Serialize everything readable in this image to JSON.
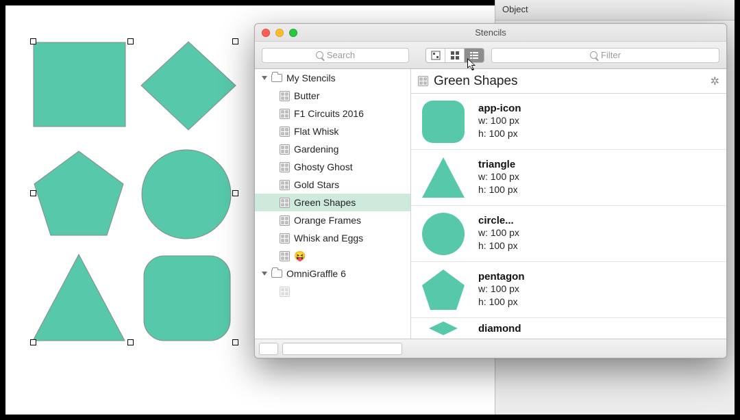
{
  "inspector": {
    "tab_label": "Object"
  },
  "canvas": {
    "shape_color": "#57c9aa"
  },
  "window": {
    "title": "Stencils",
    "search_placeholder": "Search",
    "filter_placeholder": "Filter"
  },
  "sidebar": {
    "groups": [
      {
        "label": "My Stencils",
        "items": [
          {
            "label": "Butter"
          },
          {
            "label": "F1 Circuits 2016"
          },
          {
            "label": "Flat Whisk"
          },
          {
            "label": "Gardening"
          },
          {
            "label": "Ghosty Ghost"
          },
          {
            "label": "Gold Stars"
          },
          {
            "label": "Green Shapes",
            "selected": true
          },
          {
            "label": "Orange Frames"
          },
          {
            "label": "Whisk and Eggs"
          },
          {
            "label": "😝"
          }
        ]
      },
      {
        "label": "OmniGraffle 6",
        "items": []
      }
    ]
  },
  "detail": {
    "title": "Green Shapes",
    "items": [
      {
        "name": "app-icon",
        "w": "w: 100 px",
        "h": "h: 100 px",
        "shape": "rounded"
      },
      {
        "name": "triangle",
        "w": "w: 100 px",
        "h": "h: 100 px",
        "shape": "triangle"
      },
      {
        "name": "circle...",
        "w": "w: 100 px",
        "h": "h: 100 px",
        "shape": "circle"
      },
      {
        "name": "pentagon",
        "w": "w: 100 px",
        "h": "h: 100 px",
        "shape": "pentagon"
      },
      {
        "name": "diamond",
        "w": "",
        "h": "",
        "shape": "diamond"
      }
    ]
  }
}
